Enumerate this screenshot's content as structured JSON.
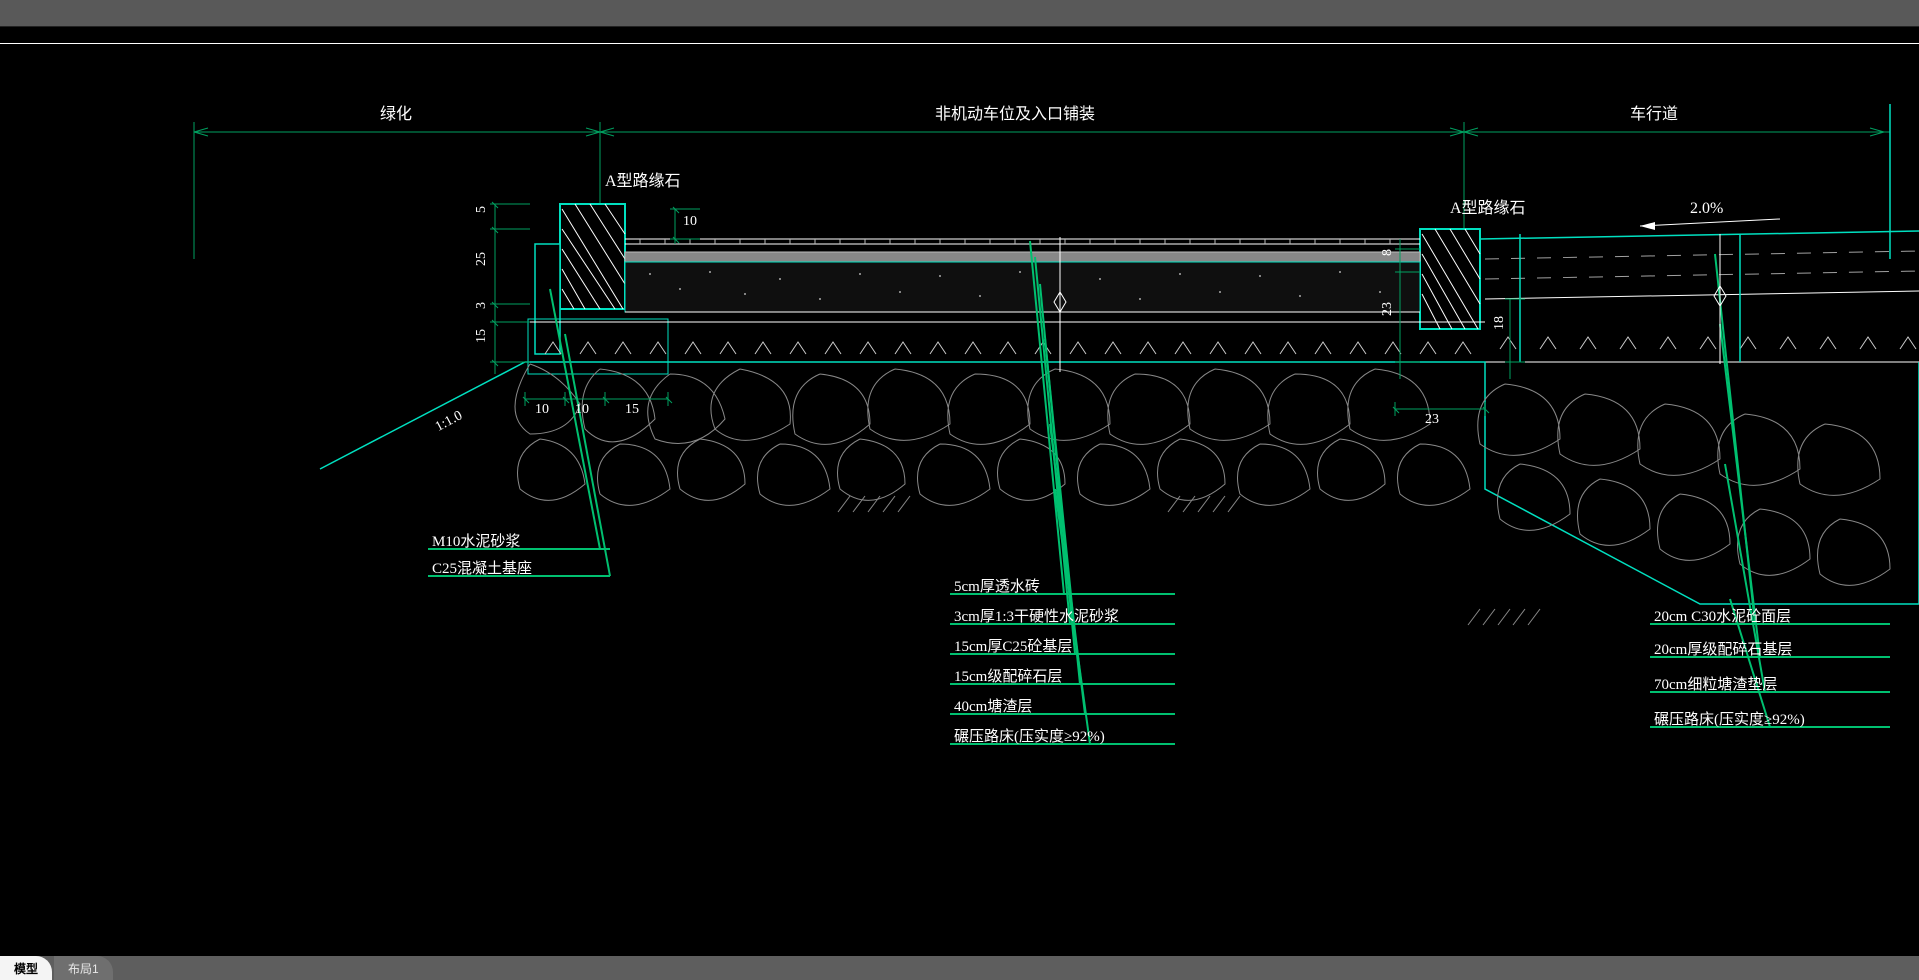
{
  "sections": {
    "left": "绿化",
    "mid": "非机动车位及入口铺装",
    "right": "车行道"
  },
  "curb": {
    "labelA_left": "A型路缘石",
    "labelA_right": "A型路缘石"
  },
  "slope": "2.0%",
  "slopeRatio": "1:1.0",
  "dims": {
    "v5": "5",
    "v25": "25",
    "v3": "3",
    "v15": "15",
    "h10a": "10",
    "h10b": "10",
    "h15": "15",
    "v10top": "10",
    "v8r": "8",
    "v23r": "23",
    "v18r": "18",
    "h23r": "23"
  },
  "callouts_left": [
    "M10水泥砂浆",
    "C25混凝土基座"
  ],
  "callouts_mid": [
    "5cm厚透水砖",
    "3cm厚1:3干硬性水泥砂浆",
    "15cm厚C25砼基层",
    "15cm级配碎石层",
    "40cm塘渣层",
    "碾压路床(压实度≥92%)"
  ],
  "callouts_right": [
    "20cm C30水泥砼面层",
    "20cm厚级配碎石基层",
    "70cm细粒塘渣垫层",
    "碾压路床(压实度≥92%)"
  ],
  "tabs": {
    "model": "模型",
    "layout1": "布局1"
  }
}
